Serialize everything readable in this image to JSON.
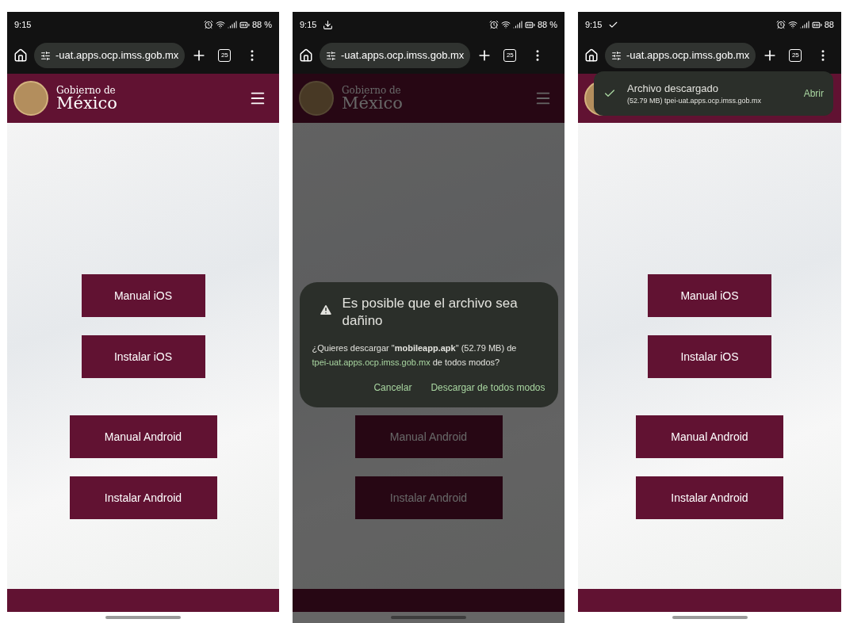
{
  "screens": [
    {
      "status_bar": {
        "time": "9:15",
        "battery": "88 %"
      },
      "browser": {
        "url": "-uat.apps.ocp.imss.gob.mx",
        "tab_count": "25"
      },
      "header": {
        "brand_top": "Gobierno de",
        "brand_main": "México"
      },
      "buttons": [
        {
          "label": "Manual iOS",
          "kind": "ios"
        },
        {
          "label": "Instalar iOS",
          "kind": "ios"
        },
        {
          "label": "Manual Android",
          "kind": "android"
        },
        {
          "label": "Instalar Android",
          "kind": "android"
        }
      ]
    },
    {
      "status_bar": {
        "time": "9:15",
        "download_complete": false,
        "battery": "88 %"
      },
      "browser": {
        "url": "-uat.apps.ocp.imss.gob.mx",
        "tab_count": "25"
      },
      "header": {
        "brand_top": "Gobierno de",
        "brand_main": "México"
      },
      "buttons": [
        {
          "label": "Manual Android",
          "kind": "android"
        },
        {
          "label": "Instalar Android",
          "kind": "android"
        }
      ],
      "dialog": {
        "title": "Es posible que el archivo sea dañino",
        "message_before": "¿Quieres descargar \"**mobileapp.apk**\" (52.79 MB) de",
        "link": "tpei-uat.apps.ocp.imss.gob.mx",
        "message_after": "de todos modos?",
        "actions": [
          "Cancelar",
          "Descargar de todos modos"
        ]
      }
    },
    {
      "status_bar": {
        "time": "9:15",
        "download_complete": true,
        "battery": "88"
      },
      "browser": {
        "url": "-uat.apps.ocp.imss.gob.mx",
        "tab_count": "25"
      },
      "buttons": [
        {
          "label": "Manual iOS",
          "kind": "ios"
        },
        {
          "label": "Instalar iOS",
          "kind": "ios"
        },
        {
          "label": "Manual Android",
          "kind": "android"
        },
        {
          "label": "Instalar Android",
          "kind": "android"
        }
      ],
      "toast": {
        "title": "Archivo descargado",
        "detail": "(52.79 MB) tpei-uat.apps.ocp.imss.gob.mx",
        "action": "Abrir"
      }
    }
  ]
}
